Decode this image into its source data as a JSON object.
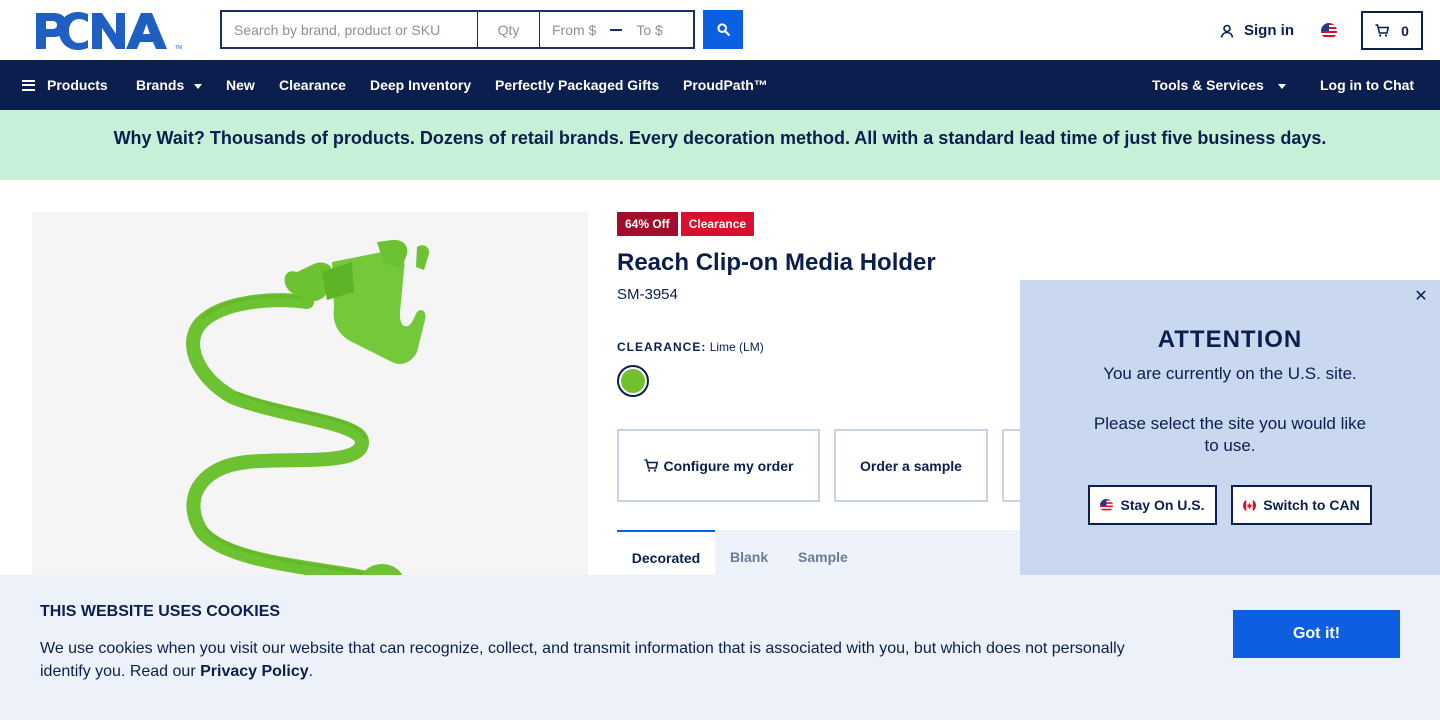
{
  "header": {
    "logo_text": "PCNA",
    "search": {
      "placeholder": "Search by brand, product or SKU",
      "value": ""
    },
    "qty": {
      "placeholder": "Qty"
    },
    "price_from": "From $",
    "price_to": "To $",
    "sign_in": "Sign in",
    "cart_count": "0"
  },
  "nav": {
    "products": "Products",
    "brands": "Brands",
    "new": "New",
    "clearance": "Clearance",
    "deep_inventory": "Deep Inventory",
    "gifts": "Perfectly Packaged Gifts",
    "proudpath": "ProudPath™",
    "tools": "Tools & Services",
    "chat": "Log in to Chat"
  },
  "promo": {
    "text": "Why Wait? Thousands of products. Dozens of retail brands. Every decoration method. All with a standard lead time of just five business days."
  },
  "product": {
    "discount_badge": "64% Off",
    "clearance_badge": "Clearance",
    "title": "Reach Clip-on Media Holder",
    "sku": "SM-3954",
    "color_label": "CLEARANCE:",
    "color_value": "Lime (LM)",
    "swatch_color": "#72c12c",
    "configure_btn": "Configure my order",
    "sample_btn": "Order a sample",
    "tabs": [
      "Decorated",
      "Blank",
      "Sample"
    ]
  },
  "site_modal": {
    "title": "ATTENTION",
    "message1": "You are currently on the U.S. site.",
    "message2": "Please select the site you would like to use.",
    "stay_btn": "Stay On U.S.",
    "switch_btn": "Switch to CAN"
  },
  "cookie": {
    "title": "THIS WEBSITE USES COOKIES",
    "text": "We use cookies when you visit our website that can recognize, collect, and transmit information that is associated with you, but which does not personally identify you. Read our ",
    "link": "Privacy Policy",
    "period": ".",
    "button": "Got it!"
  },
  "colors": {
    "navy": "#0b1e4e",
    "brand_blue": "#0b5fe0",
    "promo_bg": "#c6f0d7",
    "clearance_red": "#d9112d",
    "discount_red": "#a30d2d",
    "product_lime": "#72c12c"
  }
}
